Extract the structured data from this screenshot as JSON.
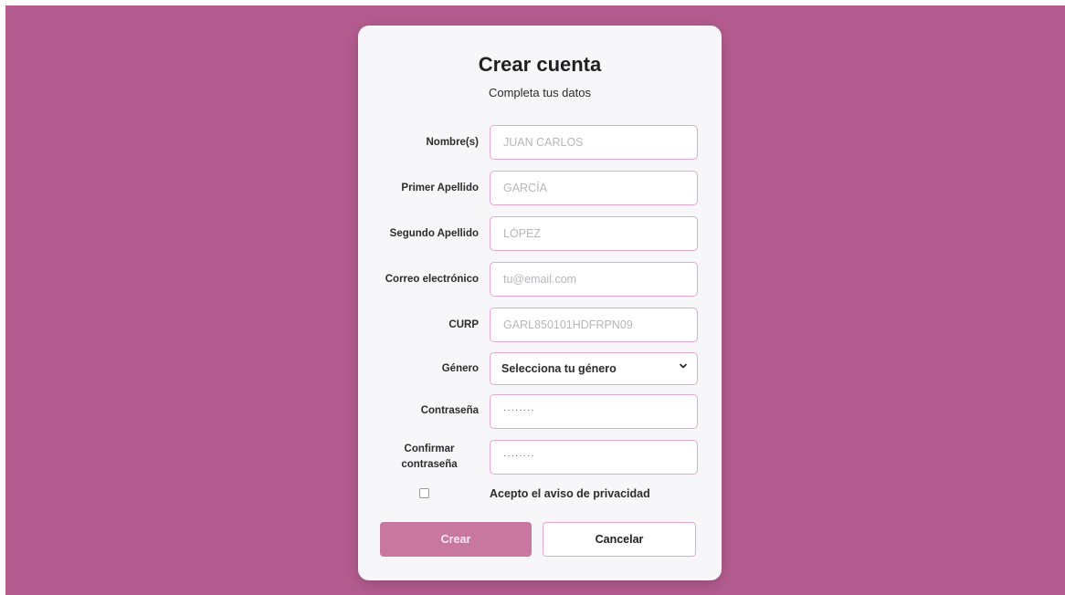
{
  "colors": {
    "backdrop": "#b45c8f",
    "card": "#f7f6f9",
    "field_border": "#e7a7cf",
    "primary_button": "#c8779f"
  },
  "header": {
    "title": "Crear cuenta",
    "subtitle": "Completa tus datos"
  },
  "form": {
    "fields": [
      {
        "label": "Nombre(s)",
        "placeholder": "JUAN CARLOS"
      },
      {
        "label": "Primer Apellido",
        "placeholder": "GARCÍA"
      },
      {
        "label": "Segundo Apellido",
        "placeholder": "LÓPEZ"
      },
      {
        "label": "Correo electrónico",
        "placeholder": "tu@email.com"
      },
      {
        "label": "CURP",
        "placeholder": "GARL850101HDFRPN09"
      }
    ],
    "gender": {
      "label": "Género",
      "selected": "Selecciona tu género",
      "icon": "chevron-down-icon"
    },
    "password": {
      "label": "Contraseña",
      "value": "········"
    },
    "confirm_password": {
      "label": "Confirmar contraseña",
      "value": "········"
    },
    "privacy": {
      "label": "Acepto el aviso de privacidad",
      "checked": false
    }
  },
  "actions": {
    "create_label": "Crear",
    "cancel_label": "Cancelar"
  }
}
